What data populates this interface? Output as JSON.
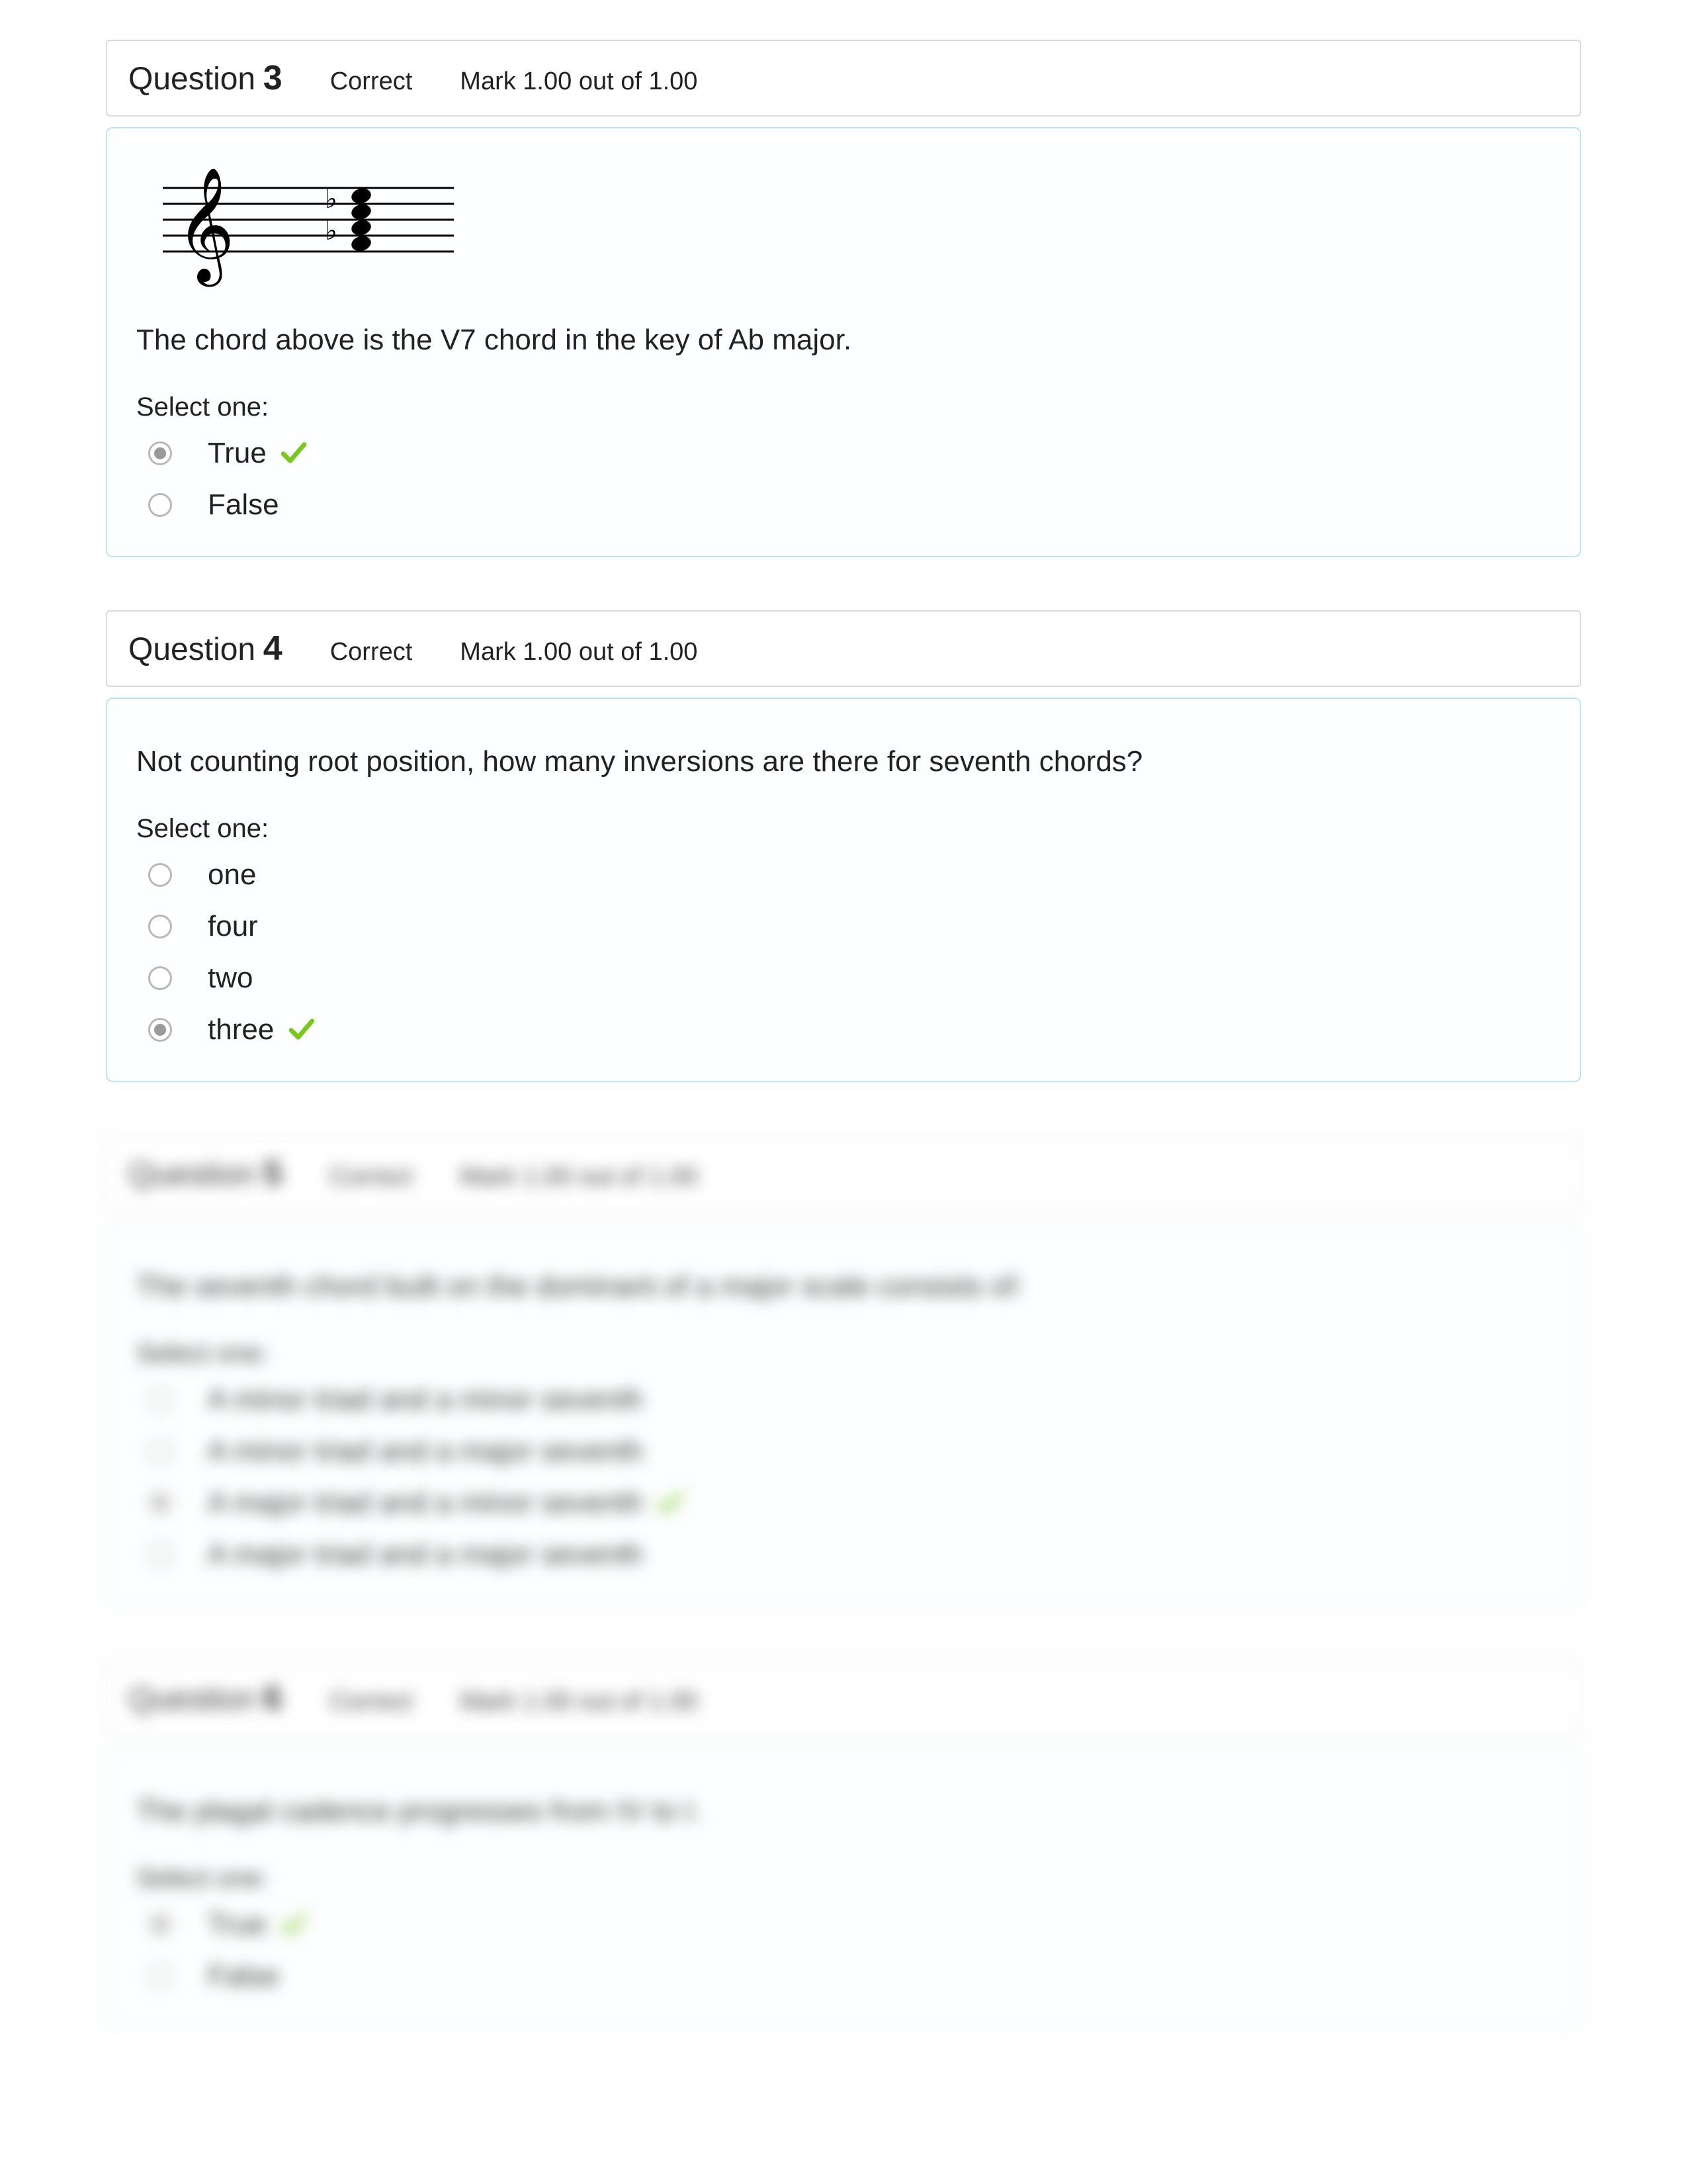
{
  "questions": [
    {
      "label": "Question",
      "number": "3",
      "status": "Correct",
      "mark": "Mark 1.00 out of 1.00",
      "has_music": true,
      "prompt": "The chord above is the V7 chord in the key of Ab major.",
      "select_label": "Select one:",
      "options": [
        {
          "text": "True",
          "selected": true,
          "correct": true
        },
        {
          "text": "False",
          "selected": false,
          "correct": false
        }
      ],
      "blurred": false
    },
    {
      "label": "Question",
      "number": "4",
      "status": "Correct",
      "mark": "Mark 1.00 out of 1.00",
      "has_music": false,
      "prompt": "Not counting root position, how many inversions are there for seventh chords?",
      "select_label": "Select one:",
      "options": [
        {
          "text": "one",
          "selected": false,
          "correct": false
        },
        {
          "text": "four",
          "selected": false,
          "correct": false
        },
        {
          "text": "two",
          "selected": false,
          "correct": false
        },
        {
          "text": "three",
          "selected": true,
          "correct": true
        }
      ],
      "blurred": false
    },
    {
      "label": "Question",
      "number": "5",
      "status": "Correct",
      "mark": "Mark 1.00 out of 1.00",
      "has_music": false,
      "prompt": "The seventh chord built on the dominant of a major scale consists of:",
      "select_label": "Select one:",
      "options": [
        {
          "text": "A minor triad and a minor seventh",
          "selected": false,
          "correct": false
        },
        {
          "text": "A minor triad and a major seventh",
          "selected": false,
          "correct": false
        },
        {
          "text": "A major triad and a minor seventh",
          "selected": true,
          "correct": true
        },
        {
          "text": "A major triad and a major seventh",
          "selected": false,
          "correct": false
        }
      ],
      "blurred": true
    },
    {
      "label": "Question",
      "number": "6",
      "status": "Correct",
      "mark": "Mark 1.00 out of 1.00",
      "has_music": false,
      "prompt": "The plagal cadence progresses from IV to I.",
      "select_label": "Select one:",
      "options": [
        {
          "text": "True",
          "selected": true,
          "correct": true
        },
        {
          "text": "False",
          "selected": false,
          "correct": false
        }
      ],
      "blurred": true
    }
  ]
}
